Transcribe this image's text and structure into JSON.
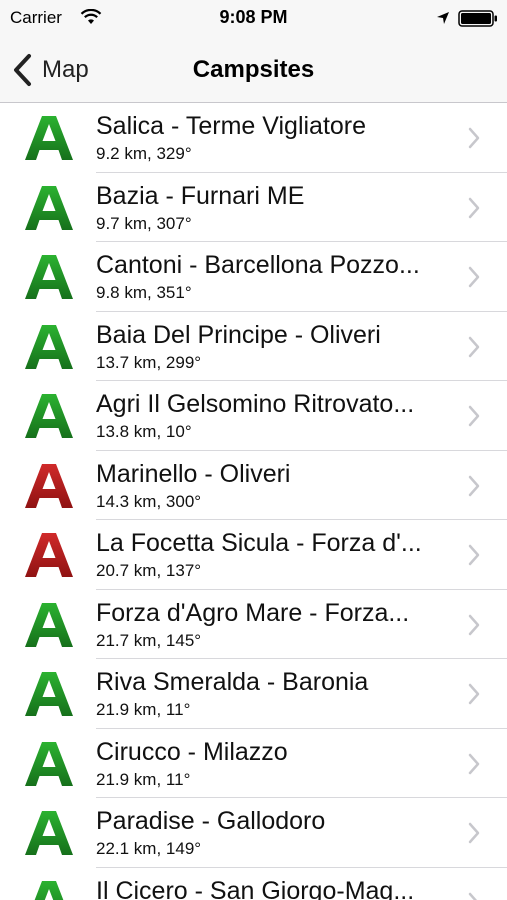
{
  "status_bar": {
    "carrier": "Carrier",
    "time": "9:08 PM"
  },
  "nav": {
    "back_label": "Map",
    "title": "Campsites"
  },
  "icons": {
    "status_green": "#2bb230",
    "status_red": "#d02a2a",
    "chevron_color": "#c7c7cc"
  },
  "campsites": [
    {
      "name": "Salica - Terme Vigliatore",
      "detail": "9.2 km, 329°",
      "status": "green"
    },
    {
      "name": "Bazia - Furnari ME",
      "detail": "9.7 km, 307°",
      "status": "green"
    },
    {
      "name": "Cantoni - Barcellona Pozzo...",
      "detail": "9.8 km, 351°",
      "status": "green"
    },
    {
      "name": "Baia Del Principe - Oliveri",
      "detail": "13.7 km, 299°",
      "status": "green"
    },
    {
      "name": "Agri Il Gelsomino Ritrovato...",
      "detail": "13.8 km, 10°",
      "status": "green"
    },
    {
      "name": "Marinello - Oliveri",
      "detail": "14.3 km, 300°",
      "status": "red"
    },
    {
      "name": "La Focetta Sicula - Forza d'...",
      "detail": "20.7 km, 137°",
      "status": "red"
    },
    {
      "name": "Forza d'Agro Mare - Forza...",
      "detail": "21.7 km, 145°",
      "status": "green"
    },
    {
      "name": "Riva Smeralda - Baronia",
      "detail": "21.9 km, 11°",
      "status": "green"
    },
    {
      "name": "Cirucco - Milazzo",
      "detail": "21.9 km, 11°",
      "status": "green"
    },
    {
      "name": "Paradise - Gallodoro",
      "detail": "22.1 km, 149°",
      "status": "green"
    },
    {
      "name": "Il Cicero - San Giorgo-Mag...",
      "detail": "",
      "status": "green"
    }
  ]
}
